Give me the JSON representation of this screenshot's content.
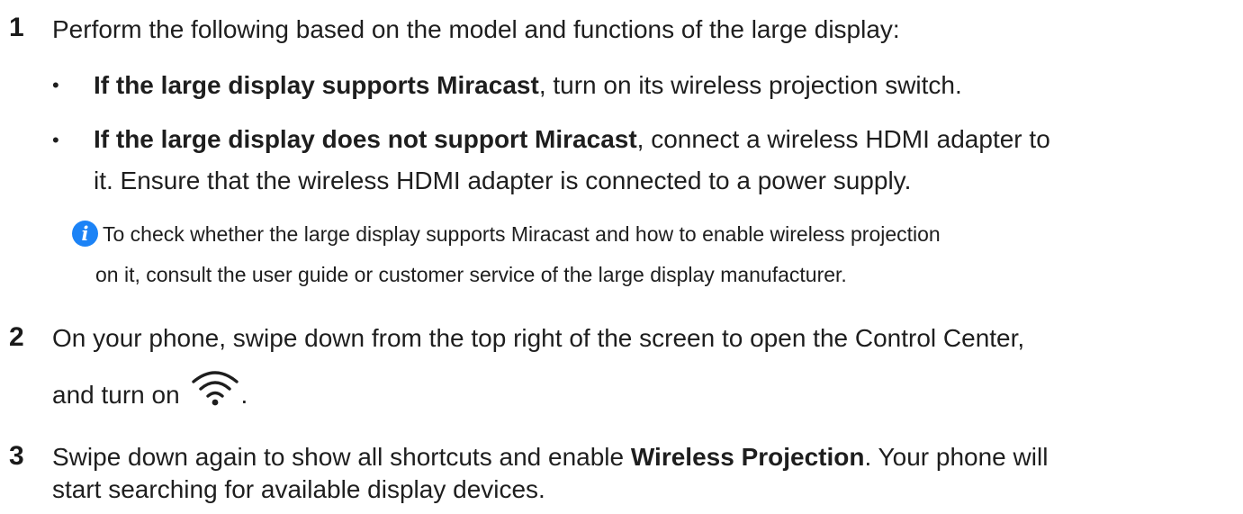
{
  "steps": [
    {
      "number": "1",
      "intro": "Perform the following based on the model and functions of the large display:",
      "bullets": [
        {
          "bold": "If the large display supports Miracast",
          "rest": ", turn on its wireless projection switch."
        },
        {
          "bold": "If the large display does not support Miracast",
          "rest": ", connect a wireless HDMI adapter to",
          "continuation": "it. Ensure that the wireless HDMI adapter is connected to a power supply."
        }
      ],
      "note": {
        "icon": "info-icon",
        "line1": "To check whether the large display supports Miracast and how to enable wireless projection",
        "line2": "on it, consult the user guide or customer service of the large display manufacturer."
      }
    },
    {
      "number": "2",
      "line1": "On your phone, swipe down from the top right of the screen to open the Control Center,",
      "line2_before": "and turn on",
      "icon": "wifi-icon",
      "line2_after": "."
    },
    {
      "number": "3",
      "line1_before": "Swipe down again to show all shortcuts and enable ",
      "line1_bold": "Wireless Projection",
      "line1_after": ". Your phone will",
      "line2": "start searching for available display devices."
    }
  ],
  "colors": {
    "text": "#1e1e1e",
    "info_icon": "#1c83f6"
  }
}
